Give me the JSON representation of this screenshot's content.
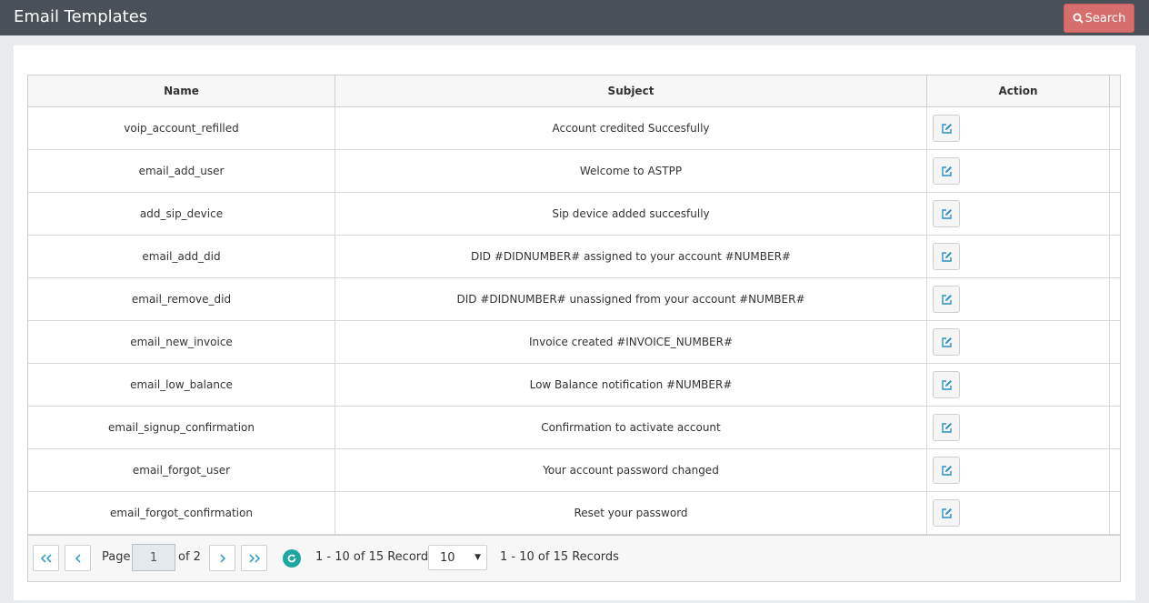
{
  "header": {
    "title": "Email Templates",
    "search_label": "Search",
    "search_color": "#d66e6e"
  },
  "table": {
    "columns": [
      "Name",
      "Subject",
      "Action"
    ],
    "rows": [
      {
        "name": "voip_account_refilled",
        "subject": "Account credited Succesfully"
      },
      {
        "name": "email_add_user",
        "subject": "Welcome to ASTPP"
      },
      {
        "name": "add_sip_device",
        "subject": "Sip device added succesfully"
      },
      {
        "name": "email_add_did",
        "subject": "DID #DIDNUMBER# assigned to your account #NUMBER#"
      },
      {
        "name": "email_remove_did",
        "subject": "DID #DIDNUMBER# unassigned from your account #NUMBER#"
      },
      {
        "name": "email_new_invoice",
        "subject": "Invoice created #INVOICE_NUMBER#"
      },
      {
        "name": "email_low_balance",
        "subject": "Low Balance notification #NUMBER#"
      },
      {
        "name": "email_signup_confirmation",
        "subject": "Confirmation to activate account"
      },
      {
        "name": "email_forgot_user",
        "subject": "Your account password changed"
      },
      {
        "name": "email_forgot_confirmation",
        "subject": "Reset your password"
      }
    ],
    "action_icon": "edit-icon"
  },
  "pager": {
    "page_label": "Page",
    "current_page": "1",
    "of_label": "of 2",
    "records_text_left": "1 - 10 of 15 Records",
    "page_size": "10",
    "records_text_right": "1 - 10 of 15 Records",
    "accent_color": "#3aa0c9",
    "refresh_color": "#1aa8a0"
  }
}
